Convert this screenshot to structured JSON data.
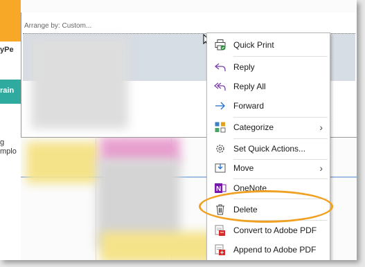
{
  "left_strip": {
    "label1": "yPe",
    "label2": "rain",
    "label3": "g\nmplo"
  },
  "panel": {
    "arrange_label": "Arrange by: Custom..."
  },
  "menu": {
    "items": [
      {
        "label": "Quick Print",
        "icon": "printer-icon"
      },
      {
        "label": "Reply",
        "icon": "reply-icon"
      },
      {
        "label": "Reply All",
        "icon": "reply-all-icon"
      },
      {
        "label": "Forward",
        "icon": "forward-icon"
      },
      {
        "label": "Categorize",
        "icon": "categorize-icon",
        "submenu": true
      },
      {
        "label": "Set Quick Actions...",
        "icon": "gear-icon"
      },
      {
        "label": "Move",
        "icon": "move-icon",
        "submenu": true
      },
      {
        "label": "OneNote",
        "icon": "onenote-icon"
      },
      {
        "label": "Delete",
        "icon": "delete-icon"
      },
      {
        "label": "Convert to Adobe PDF",
        "icon": "adobe-convert-icon"
      },
      {
        "label": "Append to Adobe PDF",
        "icon": "adobe-append-icon"
      }
    ]
  },
  "colors": {
    "highlight": "#f0a122",
    "accent": "#0078d4",
    "onenote": "#7719aa"
  }
}
